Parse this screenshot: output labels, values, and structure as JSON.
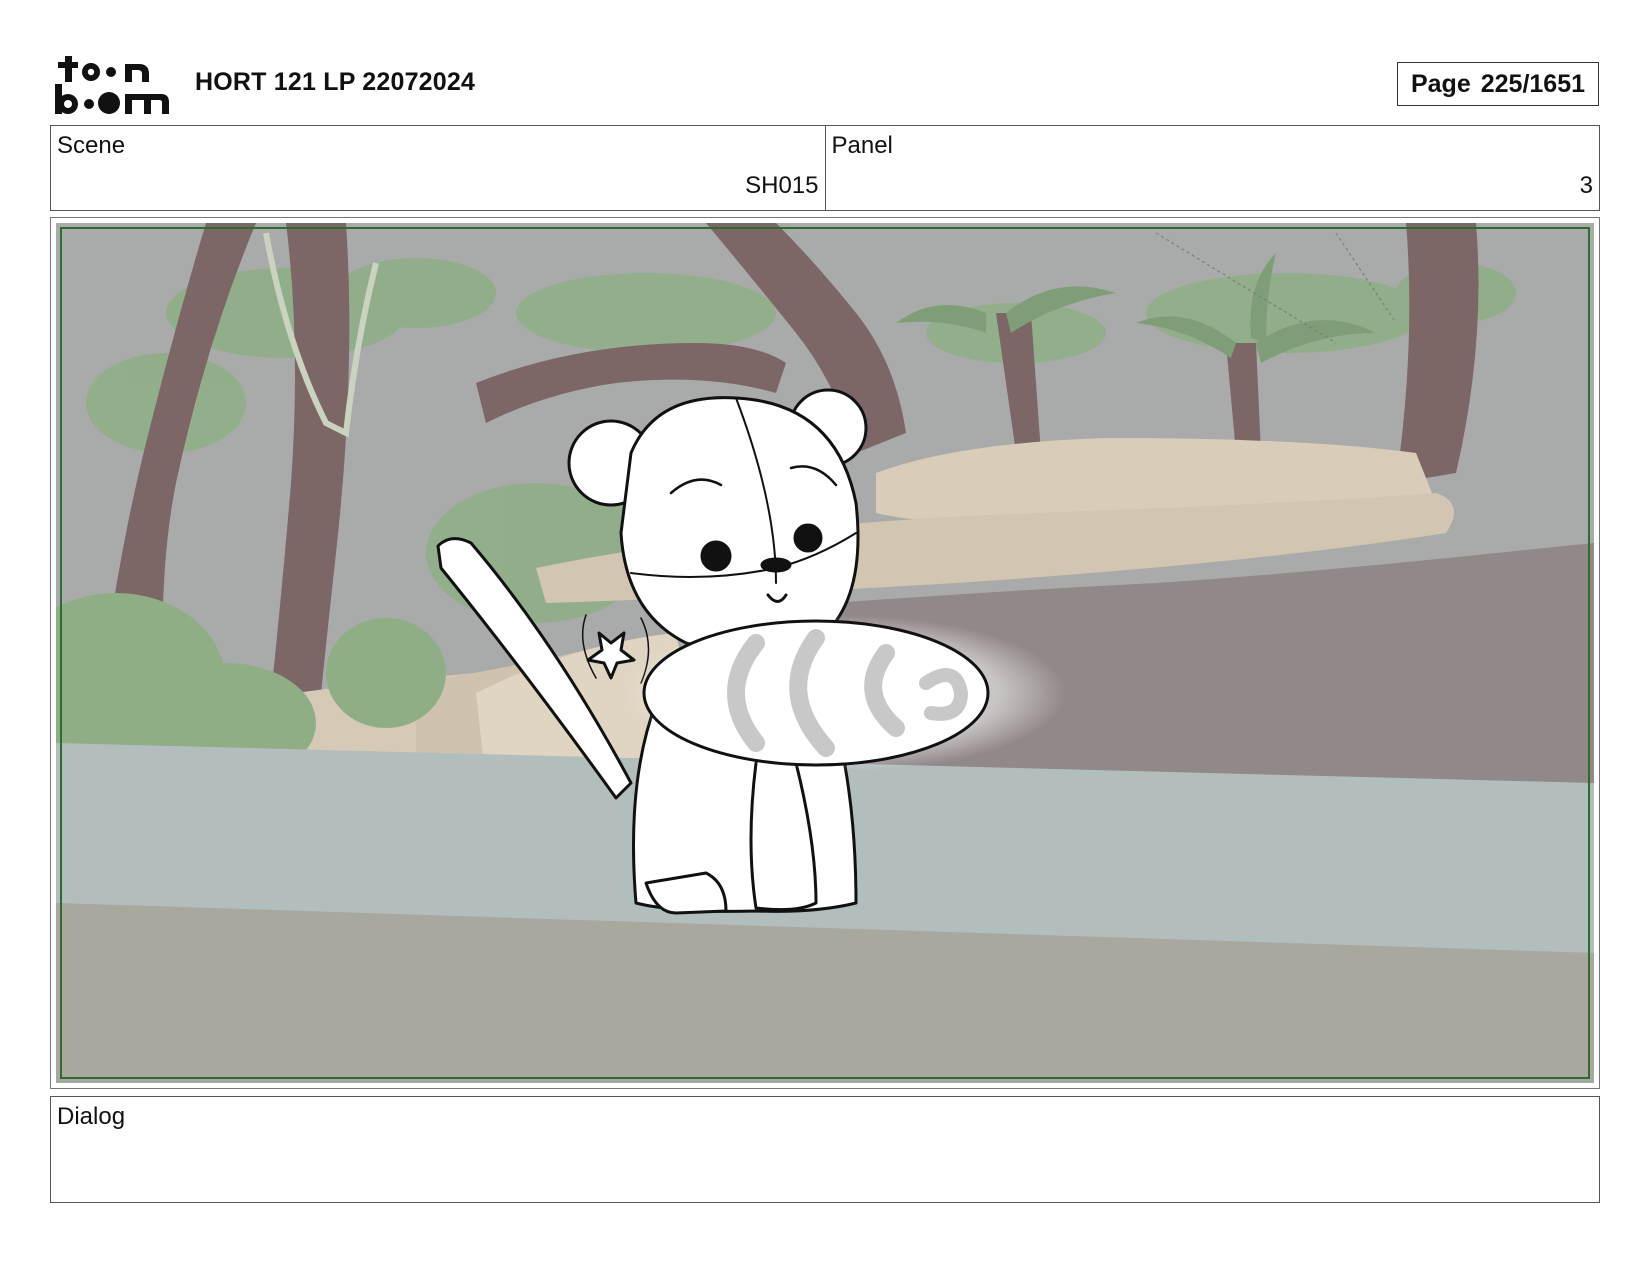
{
  "header": {
    "logo_lines": [
      "toon",
      "boom"
    ],
    "title": "HORT 121 LP 22072024",
    "page_label": "Page",
    "page_number": "225/1651"
  },
  "scene": {
    "label": "Scene",
    "value": "SH015"
  },
  "panel": {
    "label": "Panel",
    "value": "3"
  },
  "dialog": {
    "label": "Dialog",
    "text": ""
  },
  "colors": {
    "safe_frame": "#2e6b2e",
    "background_gray": "#a9abab",
    "tree_brown": "#7d6666",
    "foliage_green": "#8fae86",
    "rock_beige": "#d9cdb9",
    "water": "#b2bdbe"
  }
}
